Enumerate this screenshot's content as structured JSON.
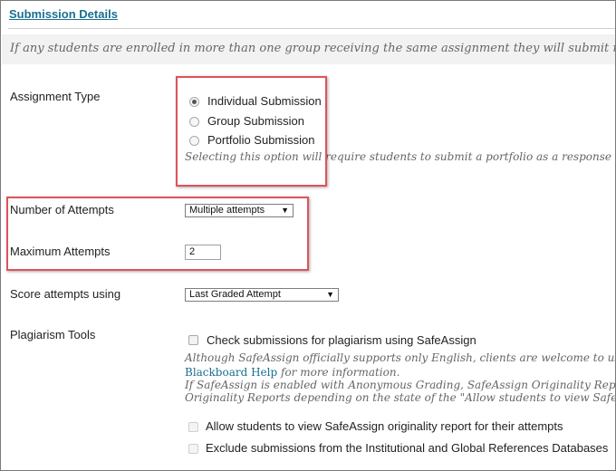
{
  "section": {
    "title": "Submission Details",
    "note": "If any students are enrolled in more than one group receiving the same assignment they will submit more than"
  },
  "assignment_type": {
    "label": "Assignment Type",
    "options": [
      {
        "label": "Individual Submission",
        "selected": true
      },
      {
        "label": "Group Submission",
        "selected": false
      },
      {
        "label": "Portfolio Submission",
        "selected": false
      }
    ],
    "hint": "Selecting this option will require students to submit a portfolio as a response to this"
  },
  "attempts": {
    "label": "Number of Attempts",
    "value": "Multiple attempts"
  },
  "max_attempts": {
    "label": "Maximum Attempts",
    "value": "2"
  },
  "score": {
    "label": "Score attempts using",
    "value": "Last Graded Attempt"
  },
  "plagiarism": {
    "label": "Plagiarism Tools",
    "check_label": "Check submissions for plagiarism using SafeAssign",
    "info_line1": "Although SafeAssign officially supports only English, clients are welcome to use Saf",
    "info_link": "Blackboard Help",
    "info_line2_rest": " for more information.",
    "info_line3": "If SafeAssign is enabled with Anonymous Grading, SafeAssign Originality Reports",
    "info_line4": "Originality Reports depending on the state of the \"Allow students to view SafeAssign",
    "allow_label": "Allow students to view SafeAssign originality report for their attempts",
    "exclude_label": "Exclude submissions from the Institutional and Global References Databases"
  },
  "colors": {
    "link": "#1a6f8f",
    "highlight": "#e0525a",
    "hint_text": "#666666"
  }
}
